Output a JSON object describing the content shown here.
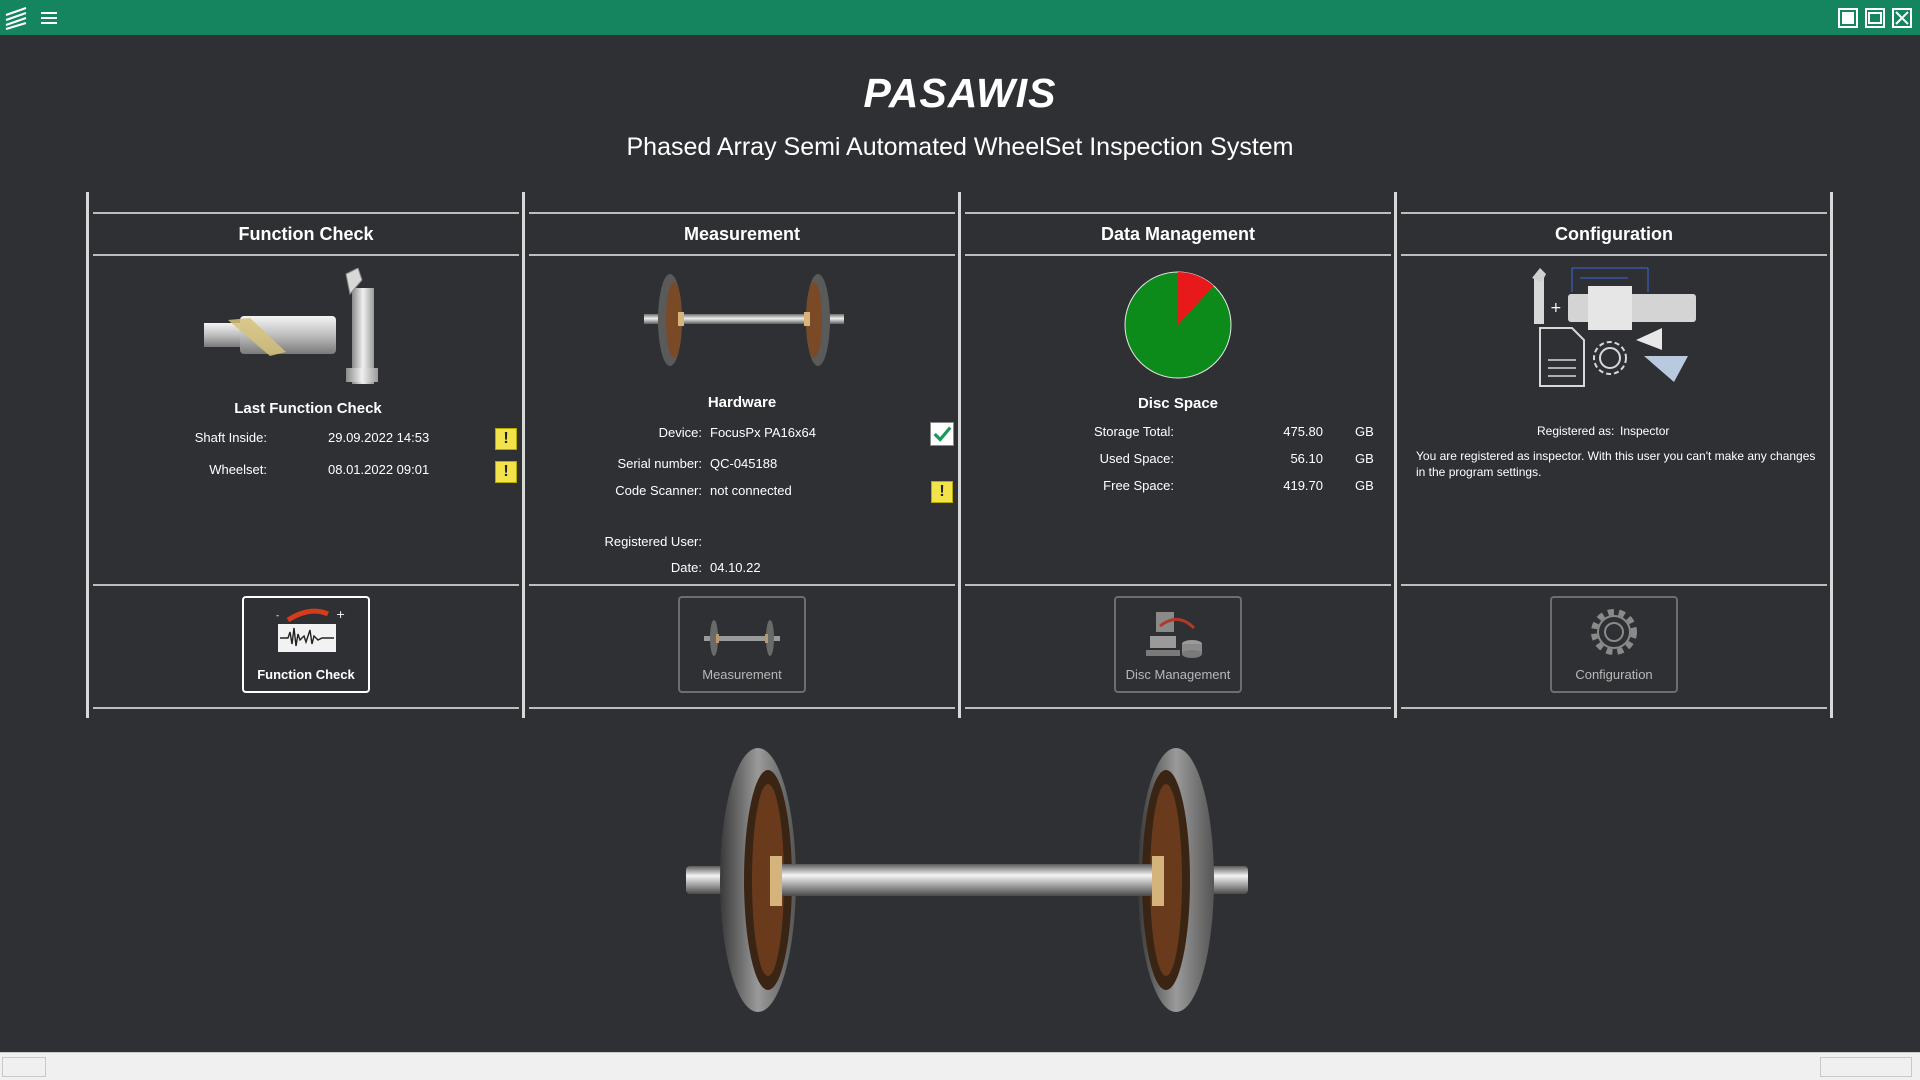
{
  "header": {
    "title": "PASAWIS",
    "subtitle": "Phased Array Semi Automated WheelSet Inspection System"
  },
  "icons": {
    "logo": "pasawis-logo-icon",
    "menu": "hamburger-menu-icon",
    "window_buttons": [
      "minimize-icon",
      "maximize-icon",
      "close-icon"
    ]
  },
  "colors": {
    "titlebar": "#14855f",
    "background": "#2e3034",
    "warning": "#f2e34a",
    "ok": "#1a9a5a",
    "disc_used": "#e8191b",
    "disc_free": "#0c8a1a"
  },
  "function_check": {
    "title": "Function Check",
    "subtitle": "Last Function Check",
    "rows": [
      {
        "label": "Shaft Inside:",
        "value": "29.09.2022 14:53",
        "status": "warning"
      },
      {
        "label": "Wheelset:",
        "value": "08.01.2022 09:01",
        "status": "warning"
      }
    ],
    "button_label": "Function Check"
  },
  "measurement": {
    "title": "Measurement",
    "subtitle": "Hardware",
    "device_label": "Device:",
    "device_value": "FocusPx PA16x64",
    "device_status": "ok",
    "serial_label": "Serial number:",
    "serial_value": "QC-045188",
    "scanner_label": "Code Scanner:",
    "scanner_value": "not connected",
    "scanner_status": "warning",
    "user_label": "Registered User:",
    "user_value": "",
    "date_label": "Date:",
    "date_value": "04.10.22",
    "button_label": "Measurement"
  },
  "data_management": {
    "title": "Data Management",
    "subtitle": "Disc Space",
    "rows": [
      {
        "label": "Storage Total:",
        "value": "475.80",
        "unit": "GB"
      },
      {
        "label": "Used Space:",
        "value": "56.10",
        "unit": "GB"
      },
      {
        "label": "Free Space:",
        "value": "419.70",
        "unit": "GB"
      }
    ],
    "used_fraction": 0.1179,
    "button_label": "Disc Management"
  },
  "configuration": {
    "title": "Configuration",
    "registered_label": "Registered as:",
    "registered_value": "Inspector",
    "note": "You are registered as inspector. With this user you can't make any changes in the program settings.",
    "button_label": "Configuration"
  }
}
